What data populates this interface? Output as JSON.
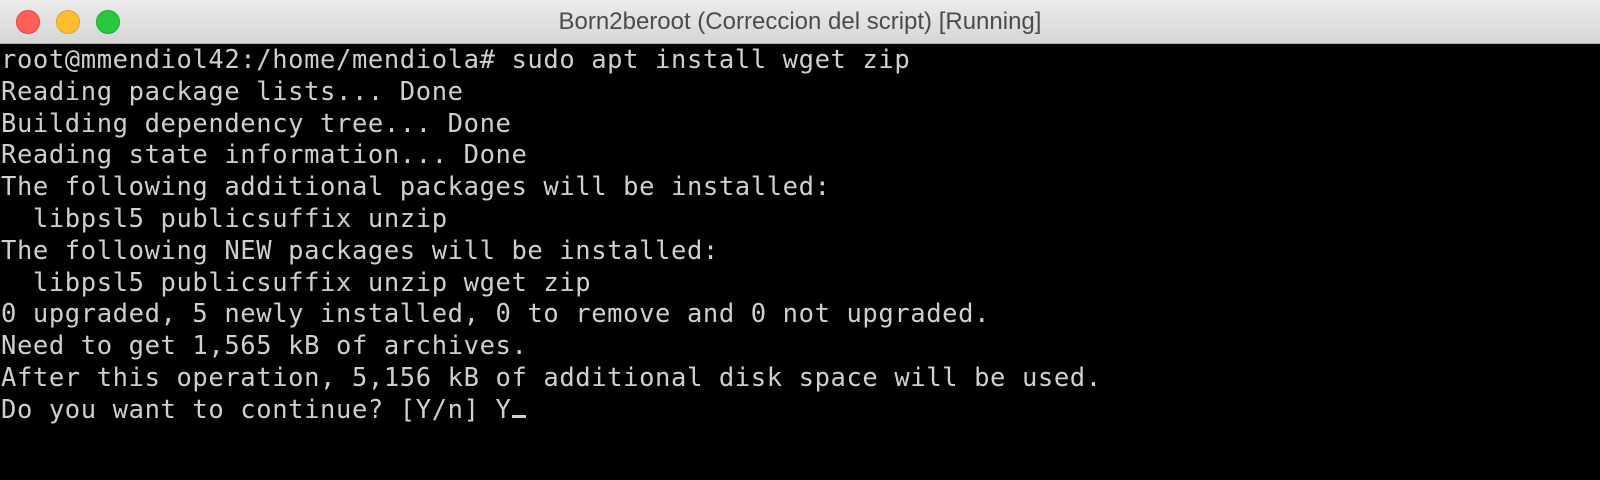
{
  "window": {
    "title": "Born2beroot (Correccion del script) [Running]",
    "controls": {
      "close_color": "#fe5f57",
      "minimize_color": "#febc2e",
      "zoom_color": "#28c840"
    }
  },
  "terminal": {
    "background": "#000000",
    "foreground": "#cfcfcf",
    "lines": [
      "root@mmendiol42:/home/mendiola# sudo apt install wget zip",
      "Reading package lists... Done",
      "Building dependency tree... Done",
      "Reading state information... Done",
      "The following additional packages will be installed:",
      "  libpsl5 publicsuffix unzip",
      "The following NEW packages will be installed:",
      "  libpsl5 publicsuffix unzip wget zip",
      "0 upgraded, 5 newly installed, 0 to remove and 0 not upgraded.",
      "Need to get 1,565 kB of archives.",
      "After this operation, 5,156 kB of additional disk space will be used.",
      "Do you want to continue? [Y/n] Y"
    ]
  }
}
